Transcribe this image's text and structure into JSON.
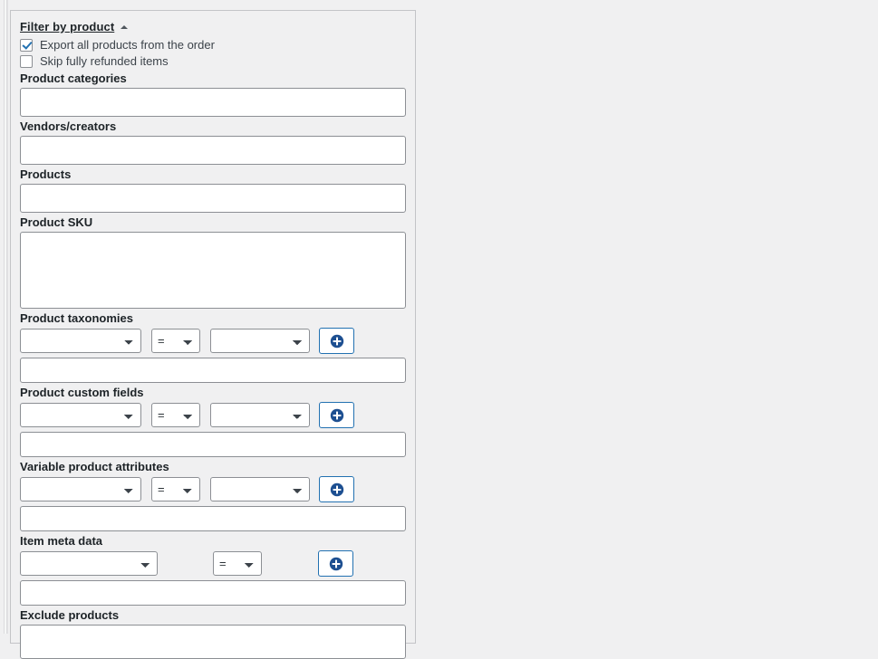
{
  "panel": {
    "section_title": "Filter by product",
    "collapse_icon": "caret-up-icon",
    "checkboxes": [
      {
        "label": "Export all products from the order",
        "checked": true
      },
      {
        "label": "Skip fully refunded items",
        "checked": false
      }
    ],
    "fields": {
      "product_categories": {
        "label": "Product categories",
        "value": "",
        "placeholder": ""
      },
      "vendors_creators": {
        "label": "Vendors/creators",
        "value": "",
        "placeholder": ""
      },
      "products": {
        "label": "Products",
        "value": "",
        "placeholder": ""
      },
      "product_sku": {
        "label": "Product SKU",
        "value": "",
        "placeholder": ""
      },
      "product_taxonomies": {
        "label": "Product taxonomies",
        "value": "",
        "placeholder": ""
      },
      "product_custom_fields": {
        "label": "Product custom fields",
        "value": "",
        "placeholder": ""
      },
      "variable_product_attributes": {
        "label": "Variable product attributes",
        "value": "",
        "placeholder": ""
      },
      "item_meta_data": {
        "label": "Item meta data",
        "value": "",
        "placeholder": ""
      },
      "exclude_products": {
        "label": "Exclude products",
        "value": "",
        "placeholder": ""
      }
    },
    "condition_rows": {
      "taxonomies": {
        "key_select": {
          "selected": "",
          "options": [
            ""
          ]
        },
        "operator_select": {
          "selected": "=",
          "options": [
            "="
          ]
        },
        "value_select": {
          "selected": "",
          "options": [
            ""
          ]
        },
        "add_button": {
          "icon": "plus-circle-icon",
          "label": ""
        }
      },
      "custom_fields": {
        "key_select": {
          "selected": "",
          "options": [
            ""
          ]
        },
        "operator_select": {
          "selected": "=",
          "options": [
            "="
          ]
        },
        "value_select": {
          "selected": "",
          "options": [
            ""
          ]
        },
        "add_button": {
          "icon": "plus-circle-icon",
          "label": ""
        }
      },
      "variable_attributes": {
        "key_select": {
          "selected": "",
          "options": [
            ""
          ]
        },
        "operator_select": {
          "selected": "=",
          "options": [
            "="
          ]
        },
        "value_select": {
          "selected": "",
          "options": [
            ""
          ]
        },
        "add_button": {
          "icon": "plus-circle-icon",
          "label": ""
        }
      },
      "item_meta": {
        "key_select": {
          "selected": "",
          "options": [
            ""
          ]
        },
        "operator_select": {
          "selected": "=",
          "options": [
            "="
          ]
        },
        "add_button": {
          "icon": "plus-circle-icon",
          "label": ""
        }
      }
    }
  },
  "colors": {
    "page_background": "#f0f0f1",
    "panel_background": "#f0f0f1",
    "panel_border": "#c3c4c7",
    "input_border": "#8c8f94",
    "input_background": "#ffffff",
    "accent_blue": "#2271b1",
    "icon_blue": "#1d4f91",
    "text": "#1d2327"
  }
}
